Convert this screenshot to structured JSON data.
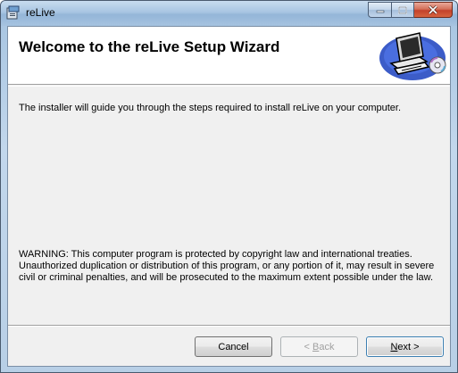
{
  "window": {
    "title": "reLive",
    "icon": "installer-icon"
  },
  "caption_buttons": {
    "minimize_icon": "minimize-icon",
    "maximize_icon": "maximize-icon",
    "close_icon": "close-icon"
  },
  "header": {
    "title": "Welcome to the reLive Setup Wizard",
    "image": "computer-cd-icon"
  },
  "body": {
    "intro": "The installer will guide you through the steps required to install reLive on your computer.",
    "warning": "WARNING: This computer program is protected by copyright law and international treaties. Unauthorized duplication or distribution of this program, or any portion of it, may result in severe civil or criminal penalties, and will be prosecuted to the maximum extent possible under the law."
  },
  "buttons": {
    "cancel": {
      "label": "Cancel",
      "enabled": true
    },
    "back": {
      "prefix": "< ",
      "mnemonic": "B",
      "rest": "ack",
      "enabled": false
    },
    "next": {
      "mnemonic": "N",
      "rest": "ext >",
      "enabled": true,
      "default": true
    }
  },
  "colors": {
    "titlebar": "#a8c5e2",
    "close_button": "#c3422a",
    "client_background": "#f0f0f0",
    "header_background": "#ffffff"
  }
}
